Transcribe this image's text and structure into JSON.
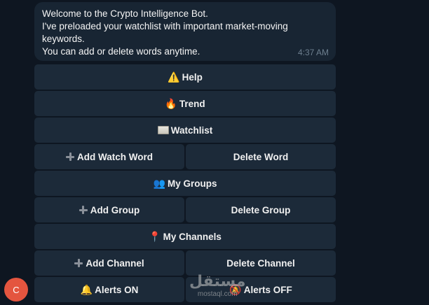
{
  "message": {
    "lines": [
      "Welcome to the Crypto Intelligence Bot.",
      "I've preloaded your watchlist with important market-moving",
      "keywords.",
      "You can add or delete words anytime."
    ],
    "time": "4:37 AM"
  },
  "keyboard": {
    "help": {
      "label": "Help",
      "icon": "warning-icon",
      "glyph": "⚠️"
    },
    "trend": {
      "label": "Trend",
      "icon": "fire-icon",
      "glyph": "🔥"
    },
    "watchlist": {
      "label": "Watchlist",
      "icon": "ledger-icon"
    },
    "add_watch_word": {
      "label": "Add Watch Word",
      "icon": "plus-icon"
    },
    "delete_word": {
      "label": "Delete Word"
    },
    "my_groups": {
      "label": "My Groups",
      "icon": "groups-icon",
      "glyph": "👥"
    },
    "add_group": {
      "label": "Add Group",
      "icon": "plus-icon"
    },
    "delete_group": {
      "label": "Delete Group"
    },
    "my_channels": {
      "label": "My Channels",
      "icon": "pin-icon",
      "glyph": "📍"
    },
    "add_channel": {
      "label": "Add Channel",
      "icon": "plus-icon"
    },
    "delete_channel": {
      "label": "Delete Channel"
    },
    "alerts_on": {
      "label": "Alerts ON",
      "icon": "bell-icon",
      "glyph": "🔔"
    },
    "alerts_off": {
      "label": "Alerts OFF",
      "icon": "bell-off-icon",
      "glyph": "🔕"
    }
  },
  "avatar": {
    "initial": "C",
    "color": "#e4553f"
  },
  "watermark": {
    "brand": "مستقل",
    "domain": "mostaql.com"
  },
  "colors": {
    "background": "#0e1621",
    "bubble": "#182533",
    "button": "#1c2a39",
    "time_text": "#6d7f8f"
  }
}
